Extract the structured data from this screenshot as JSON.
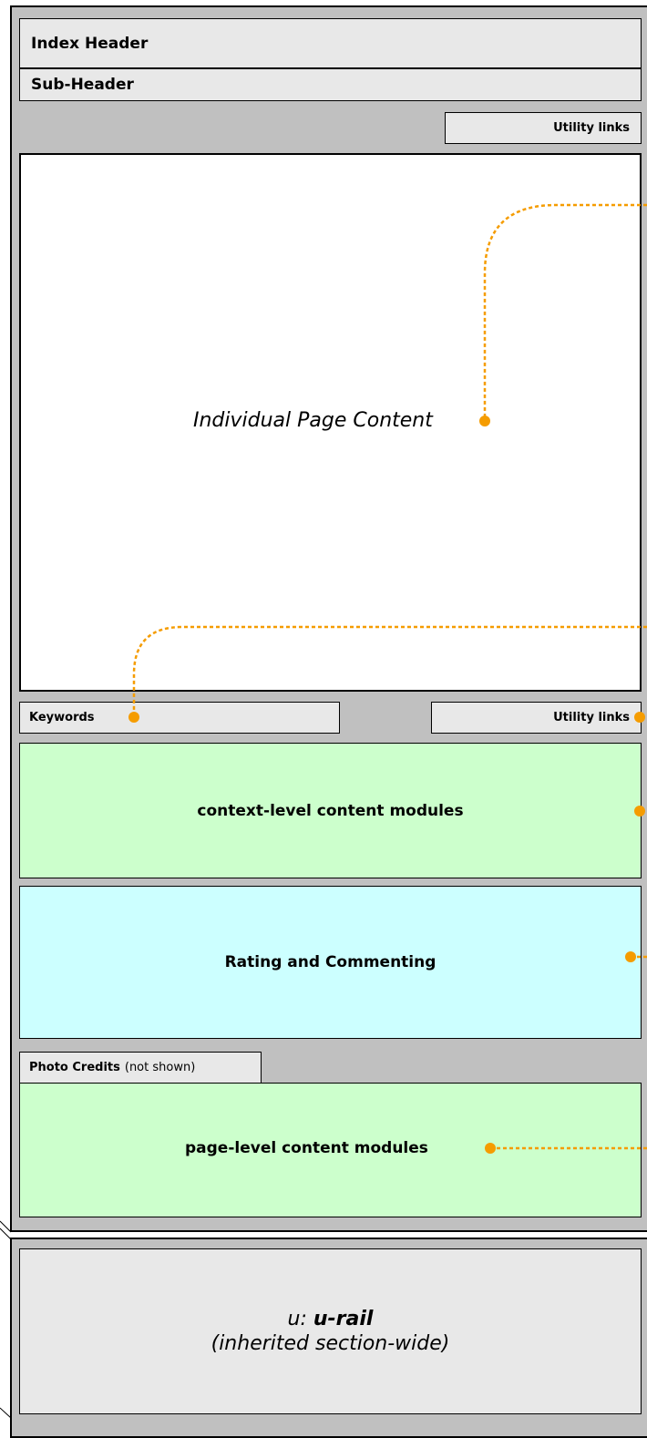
{
  "index_header": "Index Header",
  "sub_header": "Sub-Header",
  "utility_links_top": "Utility links",
  "content_label": "Individual Page Content",
  "keywords": "Keywords",
  "utility_links_bottom": "Utility links",
  "context_modules": "context-level content modules",
  "rating": "Rating and Commenting",
  "photo_credits": "Photo Credits",
  "photo_credits_note": "(not shown)",
  "page_modules": "page-level content modules",
  "urail_prefix": "u:",
  "urail_name": "u-rail",
  "urail_note": "(inherited section-wide)",
  "colors": {
    "frame": "#c0c0c0",
    "green": "#ccffcc",
    "cyan": "#ccffff",
    "connector": "#f59c00"
  }
}
